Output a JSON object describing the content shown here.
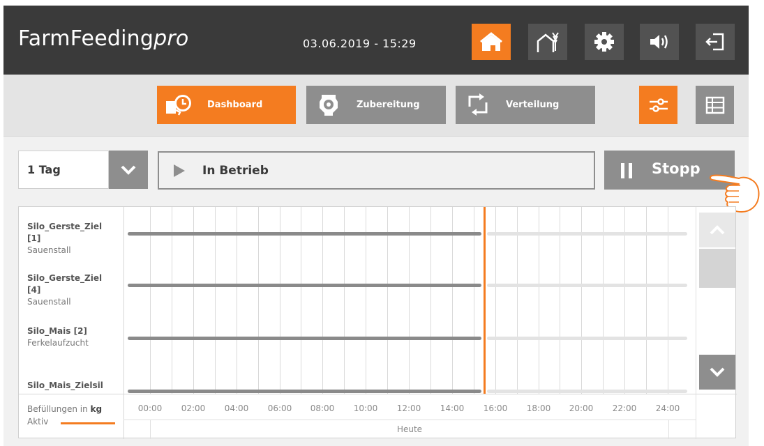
{
  "app": {
    "title_main": "FarmFeeding",
    "title_suffix": "pro"
  },
  "header": {
    "datetime": "03.06.2019 - 15:29",
    "buttons": [
      {
        "icon": "home-icon",
        "active": true
      },
      {
        "icon": "barn-grain-icon",
        "active": false
      },
      {
        "icon": "gear-icon",
        "active": false
      },
      {
        "icon": "speaker-icon",
        "active": false
      },
      {
        "icon": "logout-icon",
        "active": false
      }
    ]
  },
  "nav": {
    "tabs": [
      {
        "label": "Dashboard",
        "icon": "dashboard-clock-icon",
        "active": true
      },
      {
        "label": "Zubereitung",
        "icon": "mixer-icon",
        "active": false
      },
      {
        "label": "Verteilung",
        "icon": "distribution-arrows-icon",
        "active": false
      }
    ],
    "view_buttons": [
      {
        "icon": "filter-sliders-icon",
        "active": true
      },
      {
        "icon": "table-grid-icon",
        "active": false
      }
    ]
  },
  "controls": {
    "period": "1 Tag",
    "status": "In Betrieb",
    "stop_label": "Stopp"
  },
  "chart_data": {
    "type": "timeline",
    "x_ticks": [
      "00:00",
      "02:00",
      "04:00",
      "06:00",
      "08:00",
      "10:00",
      "12:00",
      "14:00",
      "16:00",
      "18:00",
      "20:00",
      "22:00",
      "24:00"
    ],
    "x_range_hours": [
      0,
      24
    ],
    "current_time_hours": 15.48,
    "day_label": "Heute",
    "rows": [
      {
        "name": "Silo_Gerste_Ziel [1]",
        "location": "Sauenstall",
        "active_until_hours": 15.48
      },
      {
        "name": "Silo_Gerste_Ziel [4]",
        "location": "Sauenstall",
        "active_until_hours": 15.48
      },
      {
        "name": "Silo_Mais [2]",
        "location": "Ferkelaufzucht",
        "active_until_hours": 15.48
      },
      {
        "name": "Silo_Mais_Zielsil",
        "location": "",
        "active_until_hours": 15.48
      }
    ],
    "legend": {
      "unit_text": "Befüllungen in ",
      "unit": "kg",
      "active_label": "Aktiv"
    },
    "colors": {
      "active": "#f47c20",
      "past_bar": "#8a8a8a",
      "future_bar": "#e3e3e3"
    }
  }
}
